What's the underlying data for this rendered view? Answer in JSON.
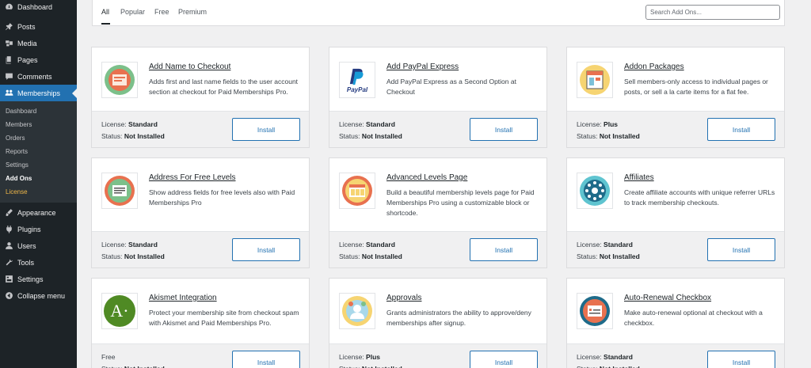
{
  "sidebar": {
    "top_items": [
      {
        "label": "Dashboard",
        "icon": "dashboard-icon"
      },
      {
        "label": "Posts",
        "icon": "pin-icon"
      },
      {
        "label": "Media",
        "icon": "media-icon"
      },
      {
        "label": "Pages",
        "icon": "pages-icon"
      },
      {
        "label": "Comments",
        "icon": "comments-icon"
      },
      {
        "label": "Memberships",
        "icon": "memberships-icon"
      }
    ],
    "submenu": [
      "Dashboard",
      "Members",
      "Orders",
      "Reports",
      "Settings",
      "Add Ons",
      "License"
    ],
    "bottom_items": [
      {
        "label": "Appearance",
        "icon": "appearance-icon"
      },
      {
        "label": "Plugins",
        "icon": "plugins-icon"
      },
      {
        "label": "Users",
        "icon": "users-icon"
      },
      {
        "label": "Tools",
        "icon": "tools-icon"
      },
      {
        "label": "Settings",
        "icon": "settings-icon"
      },
      {
        "label": "Collapse menu",
        "icon": "collapse-icon"
      }
    ]
  },
  "filters": {
    "tabs": [
      "All",
      "Popular",
      "Free",
      "Premium"
    ],
    "search_placeholder": "Search Add Ons..."
  },
  "labels": {
    "license": "License:",
    "status": "Status:",
    "install": "Install"
  },
  "cards": [
    {
      "title": "Add Name to Checkout",
      "desc": "Adds first and last name fields to the user account section at checkout for Paid Memberships Pro.",
      "license": "Standard",
      "license_label": "License:",
      "status": "Not Installed",
      "icon": "name-form-icon"
    },
    {
      "title": "Add PayPal Express",
      "desc": "Add PayPal Express as a Second Option at Checkout",
      "license": "Standard",
      "license_label": "License:",
      "status": "Not Installed",
      "icon": "paypal-logo-icon",
      "icon_text": "PayPal"
    },
    {
      "title": "Addon Packages",
      "desc": "Sell members-only access to individual pages or posts, or sell a la carte items for a flat fee.",
      "license": "Plus",
      "license_label": "License:",
      "status": "Not Installed",
      "icon": "package-icon"
    },
    {
      "title": "Address For Free Levels",
      "desc": "Show address fields for free levels also with Paid Memberships Pro",
      "license": "Standard",
      "license_label": "License:",
      "status": "Not Installed",
      "icon": "address-form-icon"
    },
    {
      "title": "Advanced Levels Page",
      "desc": "Build a beautiful membership levels page for Paid Memberships Pro using a customizable block or shortcode.",
      "license": "Standard",
      "license_label": "License:",
      "status": "Not Installed",
      "icon": "levels-page-icon"
    },
    {
      "title": "Affiliates",
      "desc": "Create affiliate accounts with unique referrer URLs to track membership checkouts.",
      "license": "Standard",
      "license_label": "License:",
      "status": "Not Installed",
      "icon": "network-icon"
    },
    {
      "title": "Akismet Integration",
      "desc": "Protect your membership site from checkout spam with Akismet and Paid Memberships Pro.",
      "license": "",
      "license_label": "Free",
      "status": "Not Installed",
      "icon": "akismet-logo-icon",
      "icon_text": "A·"
    },
    {
      "title": "Approvals",
      "desc": "Grants administrators the ability to approve/deny memberships after signup.",
      "license": "Plus",
      "license_label": "License:",
      "status": "Not Installed",
      "icon": "approval-user-icon"
    },
    {
      "title": "Auto-Renewal Checkbox",
      "desc": "Make auto-renewal optional at checkout with a checkbox.",
      "license": "Standard",
      "license_label": "License:",
      "status": "Not Installed",
      "icon": "renewal-checkbox-icon"
    }
  ]
}
